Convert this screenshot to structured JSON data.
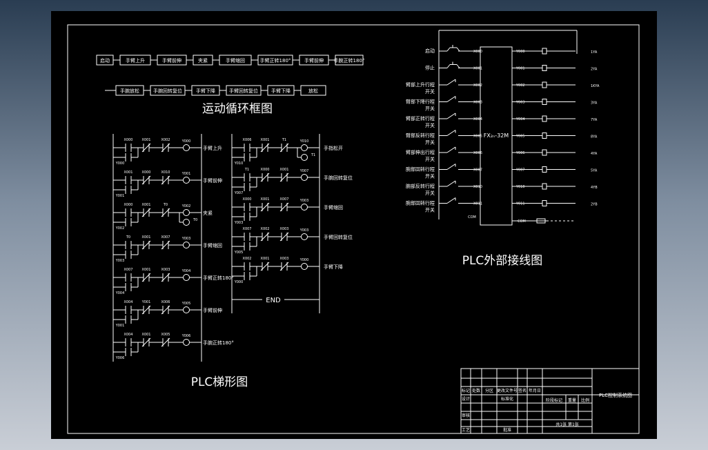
{
  "flowchart": {
    "title": "运动循环框图",
    "row1": [
      "启动",
      "手臂上升",
      "手臂前伸",
      "夹紧",
      "手臂缩回",
      "手臂正转180°",
      "手臂前伸",
      "手腕正转180°"
    ],
    "row2": [
      "手腕放松",
      "手腕回转复位",
      "手臂下降",
      "手臂回转复位",
      "手臂下降",
      "放松"
    ]
  },
  "ladder": {
    "title": "PLC梯形图",
    "left_rungs": [
      {
        "c1": "X000",
        "c2": "X001",
        "c3": "X002",
        "out": "Y000",
        "label": "手臂上升",
        "hold": "Y000"
      },
      {
        "c1": "X001",
        "c2": "X000",
        "c3": "X010",
        "out": "Y001",
        "label": "手臂前伸",
        "hold": "Y001"
      },
      {
        "c1": "X000",
        "c2": "X001",
        "c3": "T0",
        "out": "Y002",
        "label": "夹紧",
        "hold": "Y002",
        "timer": "T0"
      },
      {
        "c1": "T0",
        "c2": "X001",
        "c3": "X007",
        "out": "Y003",
        "label": "手臂缩回",
        "hold": "Y003"
      },
      {
        "c1": "X007",
        "c2": "X001",
        "c3": "X003",
        "out": "Y004",
        "label": "手臂正转180°",
        "hold": "Y004"
      },
      {
        "c1": "X004",
        "c2": "Y001",
        "c3": "X006",
        "out": "Y005",
        "label": "手臂前伸",
        "hold": "Y001"
      },
      {
        "c1": "X004",
        "c2": "X001",
        "c3": "X005",
        "out": "Y006",
        "label": "手腕正转180°",
        "hold": "Y006"
      }
    ],
    "right_rungs": [
      {
        "c1": "X006",
        "c2": "X001",
        "c3": "T1",
        "out": "Y010",
        "label": "手指松开",
        "hold": "Y010",
        "timer": "T1"
      },
      {
        "c1": "T1",
        "c2": "X000",
        "c3": "X001",
        "out": "Y007",
        "label": "手腕回转复位",
        "hold": "Y007"
      },
      {
        "c1": "X000",
        "c2": "X001",
        "c3": "X007",
        "out": "Y003",
        "label": "手臂缩回",
        "hold": "Y003"
      },
      {
        "c1": "X007",
        "c2": "X002",
        "c3": "X003",
        "out": "Y003",
        "label": "手臂回转复位",
        "hold": "Y005"
      },
      {
        "c1": "X002",
        "c2": "X001",
        "c3": "X003",
        "out": "Y000",
        "label": "手臂下降",
        "hold": "Y000"
      }
    ],
    "end_label": "END"
  },
  "wiring": {
    "title": "PLC外部接线图",
    "plc_model": "FX₂ₙ-32M",
    "inputs": [
      {
        "label": "启动",
        "addr": "X000"
      },
      {
        "label": "停止",
        "addr": "X001"
      },
      {
        "label": "臂部上升行程开关",
        "addr": "X002"
      },
      {
        "label": "臂部下降行程开关",
        "addr": "X003"
      },
      {
        "label": "臂部正转行程开关",
        "addr": "X004"
      },
      {
        "label": "臂部反转行程开关",
        "addr": "X005"
      },
      {
        "label": "臂部伸出行程开关",
        "addr": "X006"
      },
      {
        "label": "腕部回转行程开关",
        "addr": "X007"
      },
      {
        "label": "腕部反转行程开关",
        "addr": "X010"
      },
      {
        "label": "腕部回转行程开关",
        "addr": "X011"
      }
    ],
    "com_in": "COM",
    "outputs": [
      {
        "addr": "Y000",
        "tag": "1YA"
      },
      {
        "addr": "Y001",
        "tag": "2YA"
      },
      {
        "addr": "Y002",
        "tag": "1KYA"
      },
      {
        "addr": "Y003",
        "tag": "3YA"
      },
      {
        "addr": "Y004",
        "tag": "7YA"
      },
      {
        "addr": "Y005",
        "tag": "8YA"
      },
      {
        "addr": "Y006",
        "tag": "4YA"
      },
      {
        "addr": "Y007",
        "tag": "5YA"
      },
      {
        "addr": "Y010",
        "tag": "4YB"
      },
      {
        "addr": "Y011",
        "tag": "2YB"
      }
    ],
    "com_out": "COM"
  },
  "titleblock": {
    "drawing_name": "PLC控制系统图",
    "c_mark": "标记",
    "c_count": "处数",
    "c_zone": "分区",
    "c_doc": "更改文件号",
    "c_sign": "签名",
    "c_date": "年月日",
    "design": "设计",
    "std": "标准化",
    "stage": "阶段标记",
    "weight": "重量",
    "scale": "比例",
    "review": "审核",
    "process": "工艺",
    "approve": "批准",
    "sheets": "共1张 第1张"
  }
}
